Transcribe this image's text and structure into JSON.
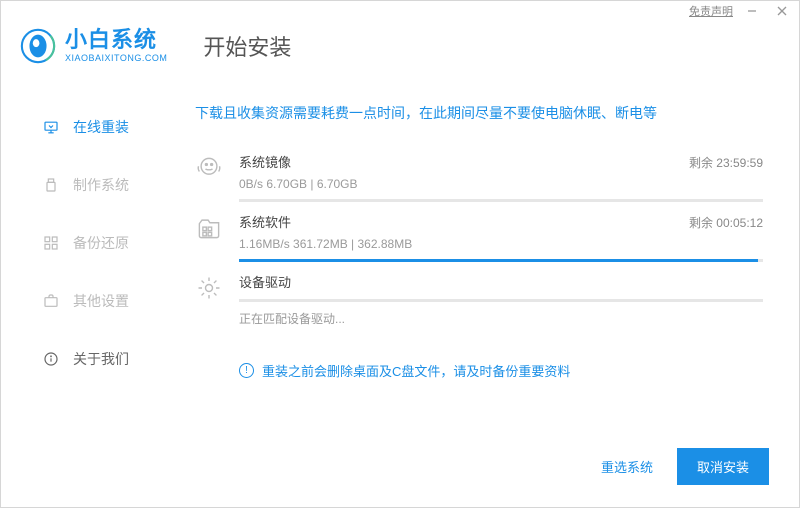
{
  "titlebar": {
    "disclaimer": "免责声明"
  },
  "brand": {
    "name": "小白系统",
    "sub": "XIAOBAIXITONG.COM"
  },
  "page": {
    "title": "开始安装"
  },
  "sidebar": {
    "items": [
      {
        "label": "在线重装",
        "icon": "monitor-download-icon",
        "active": true
      },
      {
        "label": "制作系统",
        "icon": "usb-icon",
        "active": false
      },
      {
        "label": "备份还原",
        "icon": "grid-icon",
        "active": false
      },
      {
        "label": "其他设置",
        "icon": "briefcase-icon",
        "active": false
      },
      {
        "label": "关于我们",
        "icon": "info-icon",
        "active": false
      }
    ]
  },
  "main": {
    "notice": "下载且收集资源需要耗费一点时间，在此期间尽量不要使电脑休眠、断电等",
    "tasks": [
      {
        "icon": "image-task-icon",
        "title": "系统镜像",
        "stats": "0B/s 6.70GB | 6.70GB",
        "remain": "剩余 23:59:59",
        "progress": 0,
        "sub": ""
      },
      {
        "icon": "software-task-icon",
        "title": "系统软件",
        "stats": "1.16MB/s 361.72MB | 362.88MB",
        "remain": "剩余 00:05:12",
        "progress": 99,
        "sub": ""
      },
      {
        "icon": "driver-task-icon",
        "title": "设备驱动",
        "stats": "",
        "remain": "",
        "progress": 0,
        "sub": "正在匹配设备驱动..."
      }
    ],
    "warning": "重装之前会删除桌面及C盘文件，请及时备份重要资料"
  },
  "footer": {
    "reselect": "重选系统",
    "cancel": "取消安装"
  }
}
